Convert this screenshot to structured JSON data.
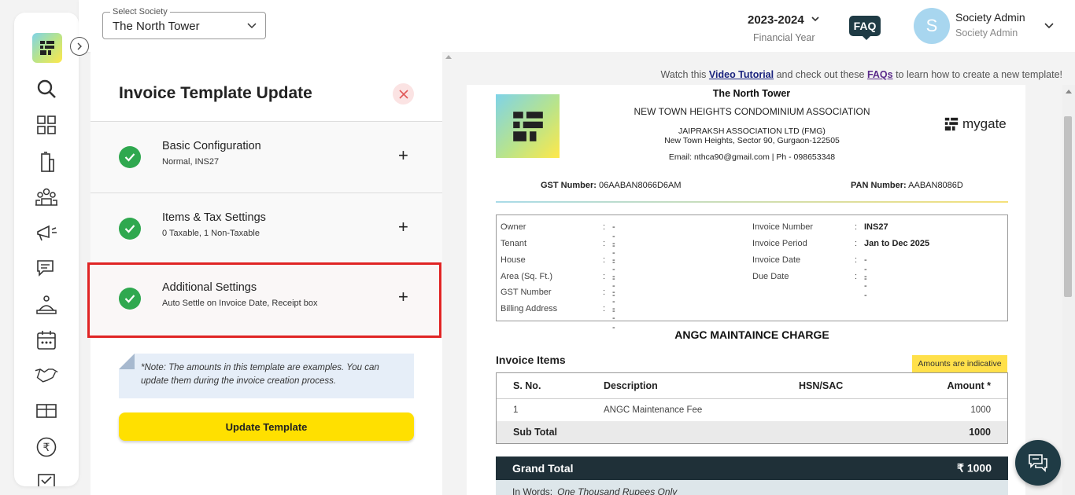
{
  "topbar": {
    "society_label": "Select Society",
    "society_value": "The North Tower",
    "financial_year": "2023-2024",
    "financial_year_label": "Financial Year",
    "faq": "FAQ",
    "avatar_letter": "S",
    "user_name": "Society Admin",
    "user_role": "Society Admin"
  },
  "sidebar": {
    "icons": [
      "search-icon",
      "dashboard-icon",
      "building-icon",
      "community-icon",
      "announcement-icon",
      "chat-icon",
      "service-icon",
      "calendar-icon",
      "handshake-icon",
      "amenities-icon",
      "rupee-icon",
      "task-icon"
    ]
  },
  "panel": {
    "title": "Invoice Template Update",
    "sections": [
      {
        "title": "Basic Configuration",
        "subtitle": "Normal, INS27"
      },
      {
        "title": "Items & Tax Settings",
        "subtitle": "0 Taxable, 1 Non-Taxable"
      },
      {
        "title": "Additional Settings",
        "subtitle": "Auto Settle on Invoice Date, Receipt box"
      }
    ],
    "note": "*Note: The amounts in this template are examples. You can update them during the invoice creation process.",
    "update_button": "Update Template"
  },
  "tutorial": {
    "prefix": "Watch this ",
    "video_link": "Video Tutorial",
    "middle": " and check out these ",
    "faqs_link": "FAQs",
    "suffix": " to learn how to create a new template!"
  },
  "invoice": {
    "society_name": "The North Tower",
    "association": "NEW TOWN HEIGHTS CONDOMINIUM ASSOCIATION",
    "company": "JAIPRAKSH ASSOCIATION LTD (FMG)",
    "address": "New Town Heights, Sector 90, Gurgaon-122505",
    "contact": "Email: nthca90@gmail.com | Ph - 098653348",
    "brand": "mygate",
    "gst_label": "GST Number:",
    "gst_value": " 06AABAN8066D6AM",
    "pan_label": "PAN Number:",
    "pan_value": " AABAN8086D",
    "left_fields": [
      {
        "key": "Owner",
        "value": "---"
      },
      {
        "key": "Tenant",
        "value": "---"
      },
      {
        "key": "House",
        "value": "---"
      },
      {
        "key": "Area (Sq. Ft.)",
        "value": "---"
      },
      {
        "key": "GST Number",
        "value": "---"
      },
      {
        "key": "Billing Address",
        "value": "---"
      }
    ],
    "right_fields": [
      {
        "key": "Invoice Number",
        "value": "INS27"
      },
      {
        "key": "Invoice Period",
        "value": "Jan to Dec 2025"
      },
      {
        "key": "Invoice Date",
        "value": "---"
      },
      {
        "key": "Due Date",
        "value": "---"
      }
    ],
    "charge_title": "ANGC MAINTAINCE CHARGE",
    "items_title": "Invoice Items",
    "indicative": "Amounts are indicative",
    "columns": {
      "sno": "S. No.",
      "desc": "Description",
      "hsn": "HSN/SAC",
      "amount": "Amount *"
    },
    "items": [
      {
        "sno": "1",
        "desc": "ANGC Maintenance Fee",
        "hsn": "",
        "amount": "1000"
      }
    ],
    "subtotal_label": "Sub Total",
    "subtotal_value": "1000",
    "grand_total_label": "Grand Total",
    "grand_total_value": "₹ 1000",
    "in_words_label": "In Words:",
    "in_words_value": "One Thousand Rupees Only"
  }
}
